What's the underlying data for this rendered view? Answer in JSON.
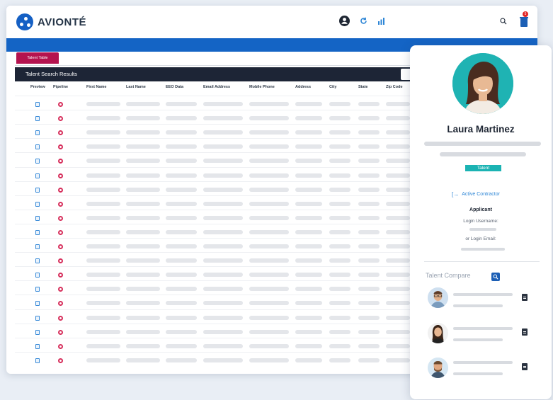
{
  "brand": {
    "name": "AVIONTÉ",
    "accent": "#1464c5"
  },
  "header": {
    "icons": [
      "user-icon",
      "refresh-icon",
      "analytics-icon",
      "search-icon",
      "notification-bin-icon"
    ],
    "notification_count": "5"
  },
  "tab": {
    "label": "Talent Table"
  },
  "results": {
    "title": "Talent Search Results",
    "columns": [
      "Preview",
      "Pipeline",
      "First Name",
      "Last Name",
      "EEO Data",
      "Email Address",
      "Mobile Phone",
      "Address",
      "City",
      "State",
      "Zip Code"
    ],
    "row_count": 19
  },
  "profile": {
    "name": "Laura Martinez",
    "tag": "Talent",
    "status": "Active Contractor",
    "role": "Applicant",
    "login_username_label": "Login Username:",
    "login_email_label": "or Login Email:",
    "compare_title": "Talent Compare",
    "compare_people": [
      "man-glasses-avatar",
      "woman-avatar",
      "man-beard-avatar"
    ]
  }
}
